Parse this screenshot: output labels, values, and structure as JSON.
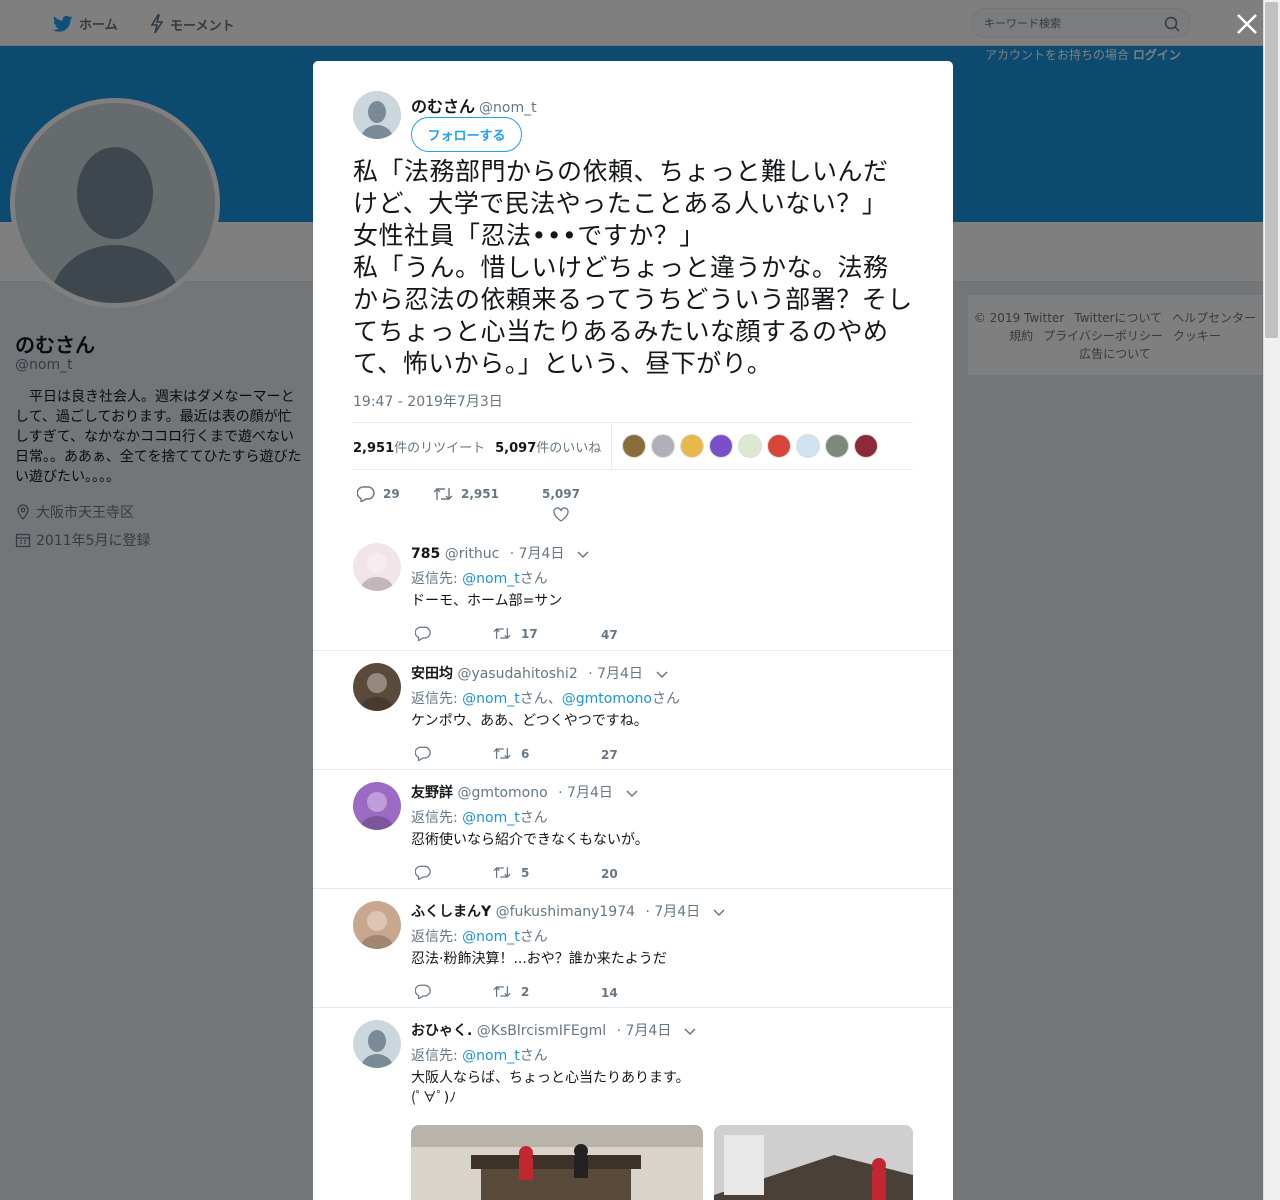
{
  "nav": {
    "home": "ホーム",
    "moments": "モーメント",
    "search_placeholder": "キーワード検索",
    "login_prompt": "アカウントをお持ちの場合",
    "login": "ログイン"
  },
  "profile": {
    "name": "のむさん",
    "handle": "@nom_t",
    "bio": "　平日は良き社会人。週末はダメなーマーとして、過ごしております。最近は表の顔が忙しすぎて、なかなかココロ行くまで遊べない日常。。ああぁ、全てを捨ててひたすら遊びたい遊びたい。。。。",
    "location": "大阪市天王寺区",
    "joined": "2011年5月に登録"
  },
  "footer": [
    "© 2019 Twitter",
    "Twitterについて",
    "ヘルプセンター",
    "規約",
    "プライバシーポリシー",
    "クッキー",
    "広告について"
  ],
  "tweet": {
    "name": "のむさん",
    "handle": "@nom_t",
    "follow_label": "フォローする",
    "text": "私「法務部門からの依頼、ちょっと難しいんだけど、大学で民法やったことある人いない？」\n女性社員「忍法•••ですか？」\n私「うん。惜しいけどちょっと違うかな。法務から忍法の依頼来るってうちどういう部署？そしてちょっと心当たりあるみたいな顔するのやめて、怖いから。」という、昼下がり。",
    "time": "19:47 - 2019年7月3日",
    "retweets_count": "2,951",
    "retweets_label": "件のリツイート",
    "likes_count": "5,097",
    "likes_label": "件のいいね",
    "reply_count": "29",
    "retweet_count": "2,951",
    "like_count": "5,097",
    "liker_colors": [
      "#8a6d3b",
      "#b0b0b8",
      "#e8b84a",
      "#7a4fc9",
      "#dce8d0",
      "#d9453a",
      "#cfe3f3",
      "#7d8a7a",
      "#8c2a3a"
    ]
  },
  "replies": [
    {
      "name": "785",
      "handle": "@rithuc",
      "date": "· 7月4日",
      "to_prefix": "返信先: ",
      "to": [
        {
          "user": "@nom_t",
          "suffix": "さん"
        }
      ],
      "text": "ドーモ、ホーム部=サン",
      "retweets": "17",
      "likes": "47",
      "avatar_color": "#f1e4ea"
    },
    {
      "name": "安田均",
      "handle": "@yasudahitoshi2",
      "date": "· 7月4日",
      "to_prefix": "返信先: ",
      "to": [
        {
          "user": "@nom_t",
          "suffix": "さん、"
        },
        {
          "user": "@gmtomono",
          "suffix": "さん"
        }
      ],
      "text": "ケンポウ、ああ、どつくやつですね。",
      "retweets": "6",
      "likes": "27",
      "avatar_color": "#5a4a3a"
    },
    {
      "name": "友野詳",
      "handle": "@gmtomono",
      "date": "· 7月4日",
      "to_prefix": "返信先: ",
      "to": [
        {
          "user": "@nom_t",
          "suffix": "さん"
        }
      ],
      "text": "忍術使いなら紹介できなくもないが。",
      "retweets": "5",
      "likes": "20",
      "avatar_color": "#9b6bc4"
    },
    {
      "name": "ふくしまんY",
      "handle": "@fukushimany1974",
      "date": "· 7月4日",
      "to_prefix": "返信先: ",
      "to": [
        {
          "user": "@nom_t",
          "suffix": "さん"
        }
      ],
      "text": "忍法·粉飾決算！...おや？誰か来たようだ",
      "retweets": "2",
      "likes": "14",
      "avatar_color": "#c9a78e"
    },
    {
      "name": "おひゃく.",
      "handle": "@KsBlrcismIFEgml",
      "date": "· 7月4日",
      "to_prefix": "返信先: ",
      "to": [
        {
          "user": "@nom_t",
          "suffix": "さん"
        }
      ],
      "text": "大阪人ならば、ちょっと心当たりあります。\n(ﾟ∀ﾟ)ﾉ",
      "retweets": "",
      "likes": "",
      "avatar_color": "#ccd6dd"
    }
  ]
}
